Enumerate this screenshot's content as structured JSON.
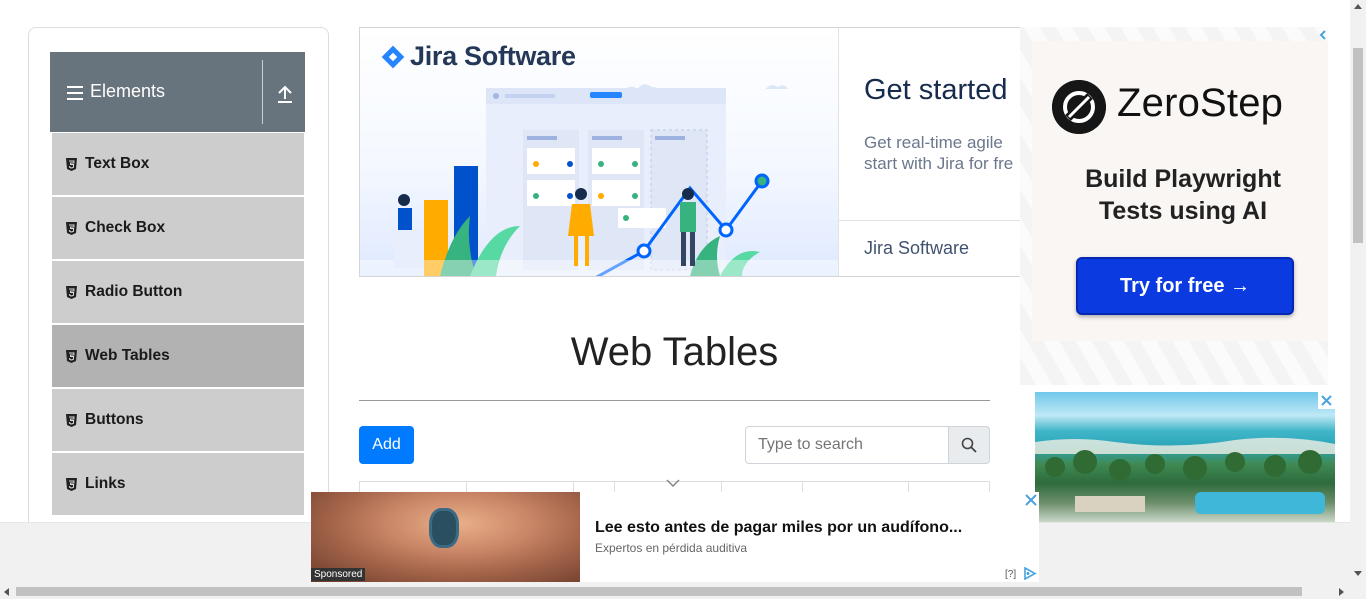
{
  "sidebar": {
    "group_title": "Elements",
    "items": [
      {
        "label": "Text Box",
        "active": false
      },
      {
        "label": "Check Box",
        "active": false
      },
      {
        "label": "Radio Button",
        "active": false
      },
      {
        "label": "Web Tables",
        "active": true
      },
      {
        "label": "Buttons",
        "active": false
      },
      {
        "label": "Links",
        "active": false
      }
    ]
  },
  "jira_ad": {
    "logo_text": "Jira Software",
    "headline": "Get started",
    "subtext_line1": "Get real-time agile",
    "subtext_line2": "start with Jira for fre",
    "brand": "Jira Software",
    "accent_color": "#2684ff"
  },
  "zerostep_ad": {
    "logo_text": "ZeroStep",
    "tagline_line1": "Build Playwright",
    "tagline_line2": "Tests using AI",
    "cta": "Try for free →",
    "cta_color": "#0a3ae0"
  },
  "main": {
    "title": "Web Tables",
    "add_label": "Add",
    "search_placeholder": "Type to search",
    "add_color": "#007bff"
  },
  "native_ad": {
    "sponsored_label": "Sponsored",
    "title": "Lee esto antes de pagar miles por un audífono...",
    "source": "Expertos en pérdida auditiva",
    "help": "[?]"
  }
}
